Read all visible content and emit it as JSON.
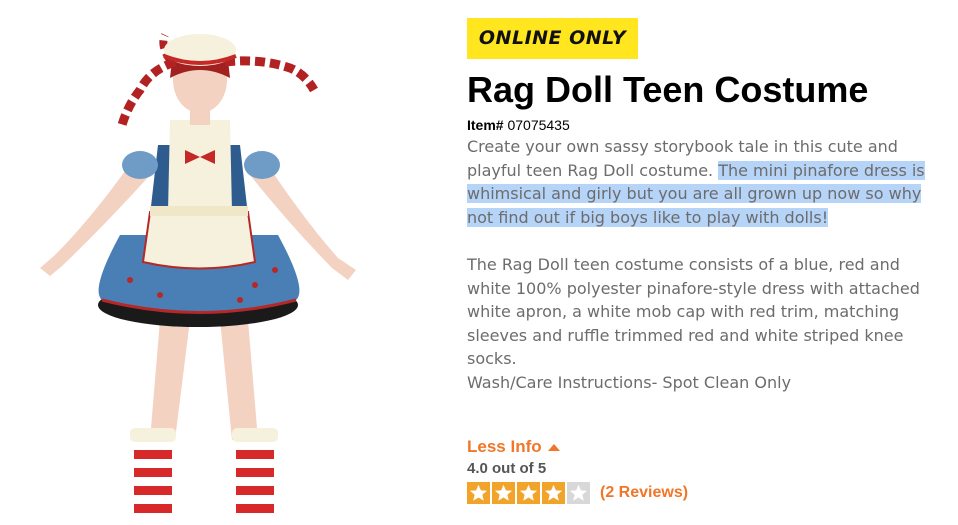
{
  "product": {
    "badge": "ONLINE ONLY",
    "title": "Rag Doll Teen Costume",
    "item_label": "Item#",
    "item_number": "07075435",
    "description": {
      "intro": "Create your own sassy storybook tale in this cute and playful teen Rag Doll costume. ",
      "highlighted": "The mini pinafore dress is whimsical and girly but you are all grown up now so why not find out if big boys like to play with dolls!",
      "details": "The Rag Doll teen costume consists of a blue, red and white 100% polyester pinafore-style dress with attached white apron, a white mob cap with red trim, matching sleeves and ruffle trimmed red and white striped knee socks.",
      "care": "Wash/Care Instructions- Spot Clean Only"
    },
    "less_info_label": "Less Info",
    "rating": {
      "text": "4.0 out of 5",
      "value": 4,
      "max": 5,
      "reviews_label": "(2 Reviews)"
    }
  },
  "colors": {
    "badge_bg": "#ffe61e",
    "accent": "#f0762a",
    "highlight": "#b6d4f7",
    "star_filled": "#f2a32a",
    "star_empty": "#d8d8d8"
  },
  "icons": [
    "caret-up-icon",
    "star-icon"
  ]
}
